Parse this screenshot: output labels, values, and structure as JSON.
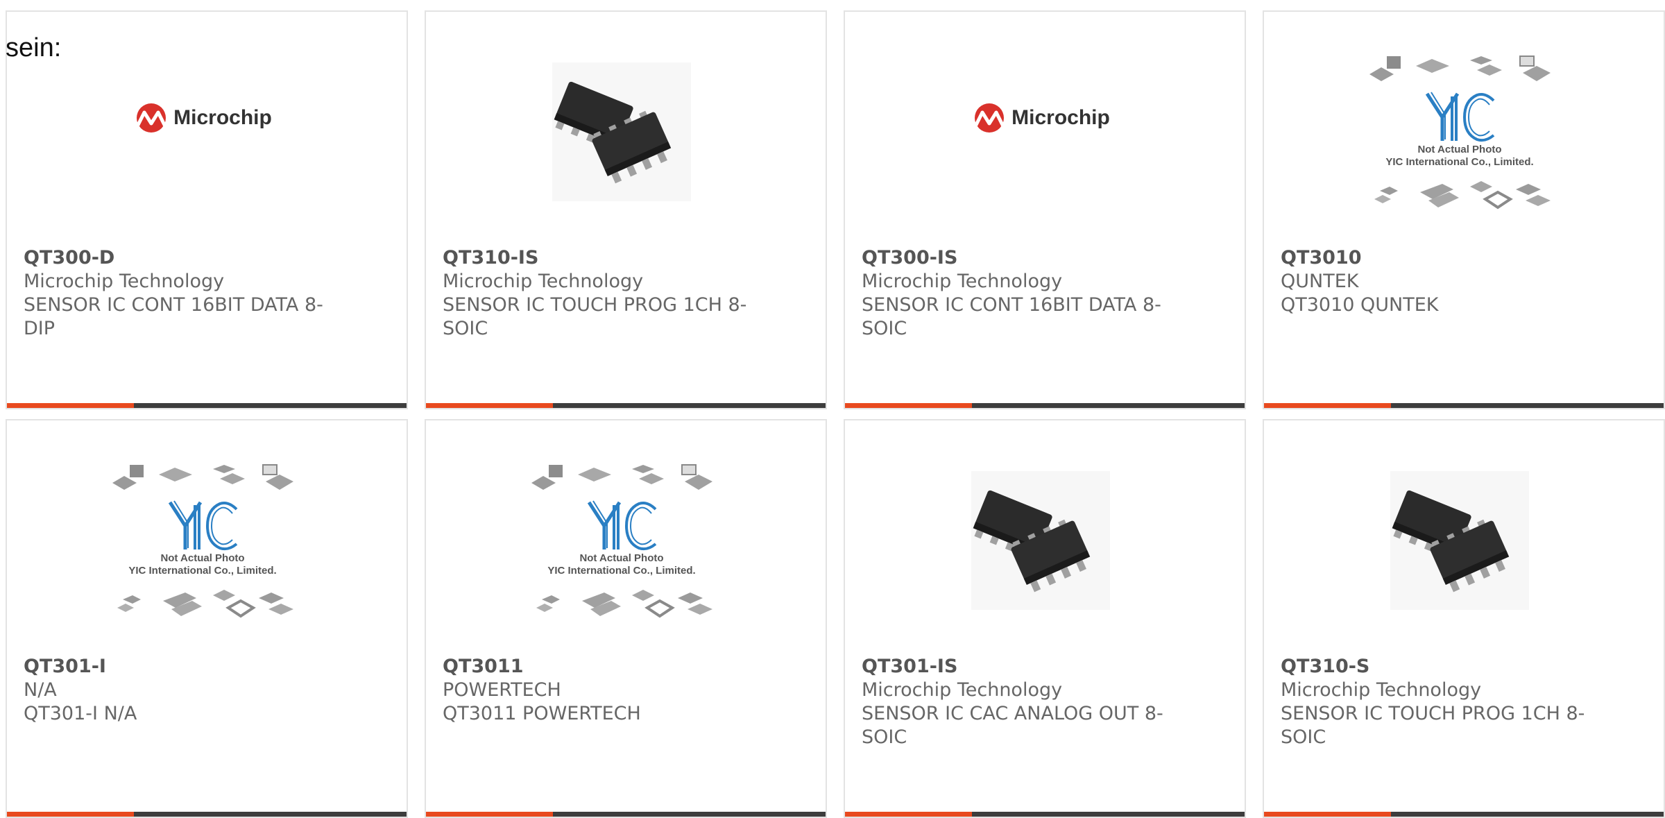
{
  "heading": "sein:",
  "placeholder": {
    "line1": "Not Actual Photo",
    "line2": "YIC International Co., Limited."
  },
  "logo_text": "Microchip",
  "colors": {
    "accent_bar": "#e84a1f",
    "dark_bar": "#3d3d3d",
    "logo_red": "#d9312b"
  },
  "products": [
    {
      "part": "QT300-D",
      "manufacturer": "Microchip Technology",
      "desc1": "SENSOR IC CONT 16BIT DATA 8-",
      "desc2": "DIP",
      "image": "microchip-logo"
    },
    {
      "part": "QT310-IS",
      "manufacturer": "Microchip Technology",
      "desc1": "SENSOR IC TOUCH PROG 1CH 8-",
      "desc2": "SOIC",
      "image": "soic-chip-photo"
    },
    {
      "part": "QT300-IS",
      "manufacturer": "Microchip Technology",
      "desc1": "SENSOR IC CONT 16BIT DATA 8-",
      "desc2": "SOIC",
      "image": "microchip-logo"
    },
    {
      "part": "QT3010",
      "manufacturer": "QUNTEK",
      "desc1": "QT3010 QUNTEK",
      "desc2": "",
      "image": "yic-placeholder"
    },
    {
      "part": "QT301-I",
      "manufacturer": "N/A",
      "desc1": "QT301-I N/A",
      "desc2": "",
      "image": "yic-placeholder"
    },
    {
      "part": "QT3011",
      "manufacturer": "POWERTECH",
      "desc1": "QT3011 POWERTECH",
      "desc2": "",
      "image": "yic-placeholder"
    },
    {
      "part": "QT301-IS",
      "manufacturer": "Microchip Technology",
      "desc1": "SENSOR IC CAC ANALOG OUT 8-",
      "desc2": "SOIC",
      "image": "soic-chip-photo"
    },
    {
      "part": "QT310-S",
      "manufacturer": "Microchip Technology",
      "desc1": "SENSOR IC TOUCH PROG 1CH 8-",
      "desc2": "SOIC",
      "image": "soic-chip-photo"
    }
  ]
}
